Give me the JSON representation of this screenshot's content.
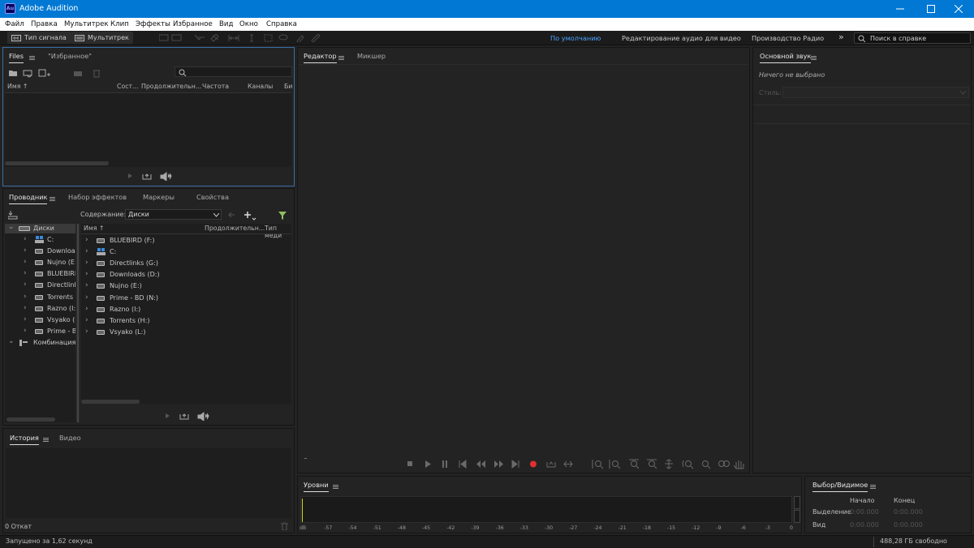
{
  "window": {
    "title": "Adobe Audition",
    "logo_text": "Au"
  },
  "menu": [
    "Файл",
    "Правка",
    "Мультитрек",
    "Клип",
    "Эффекты",
    "Избранное",
    "Вид",
    "Окно",
    "Справка"
  ],
  "toolbar": {
    "waveform_label": "Тип сигнала",
    "multitrack_label": "Мультитрек"
  },
  "workspaces": {
    "default": "По умолчанию",
    "video": "Редактирование аудио для видео",
    "radio": "Производство Радио",
    "more": "»",
    "help_placeholder": "Поиск в справке"
  },
  "files_panel": {
    "tabs": [
      "Files",
      "\"Избранное\""
    ],
    "columns": [
      "Имя ↑",
      "Сост...",
      "Продолжительн...",
      "Частота",
      "Каналы",
      "Би"
    ]
  },
  "browser_panel": {
    "tabs": [
      "Проводник",
      "Набор эффектов",
      "Маркеры",
      "Свойства"
    ],
    "content_label": "Содержание:",
    "content_value": "Диски",
    "tree_root": "Диски",
    "tree_items": [
      "C:",
      "Downloads (D:)",
      "Nujno (E:)",
      "BLUEBIRD (F:)",
      "Directlinks (G:)",
      "Torrents (H:)",
      "Razno (I:)",
      "Vsyako (L:)",
      "Prime - BD (N:)"
    ],
    "tree_combo": "Комбинация",
    "columns": [
      "Имя ↑",
      "Продолжительн...",
      "Тип меди"
    ],
    "list_items": [
      "BLUEBIRD (F:)",
      "C:",
      "Directlinks (G:)",
      "Downloads (D:)",
      "Nujno (E:)",
      "Prime - BD (N:)",
      "Razno (I:)",
      "Torrents (H:)",
      "Vsyako (L:)"
    ]
  },
  "history_panel": {
    "tabs": [
      "История",
      "Видео"
    ],
    "undo_count": "0 Откат"
  },
  "editor_panel": {
    "tabs": [
      "Редактор",
      "Микшер"
    ]
  },
  "essential_sound": {
    "title": "Основной звук",
    "nothing_selected": "Ничего не выбрано",
    "style_label": "Стиль:"
  },
  "levels": {
    "title": "Уровни",
    "ticks": [
      "dB",
      "-57",
      "-54",
      "-51",
      "-48",
      "-45",
      "-42",
      "-39",
      "-36",
      "-33",
      "-30",
      "-27",
      "-24",
      "-21",
      "-18",
      "-15",
      "-12",
      "-9",
      "-6",
      "-3",
      "0"
    ]
  },
  "selection_view": {
    "title": "Выбор/Видимое",
    "col_start": "Начало",
    "col_end": "Конец",
    "row_selection": "Выделение",
    "row_view": "Вид",
    "sel_start": "0:00.000",
    "sel_end": "0:00.000",
    "view_start": "0:00.000",
    "view_end": "0:00.000"
  },
  "status": {
    "left": "Запущено за 1,62 секунд",
    "right": "488,28 ГБ свободно"
  },
  "colors": {
    "accent": "#0078d4",
    "ws_active": "#4aa2ff",
    "record": "#e03030",
    "panel_focus": "#3a6ea5"
  }
}
